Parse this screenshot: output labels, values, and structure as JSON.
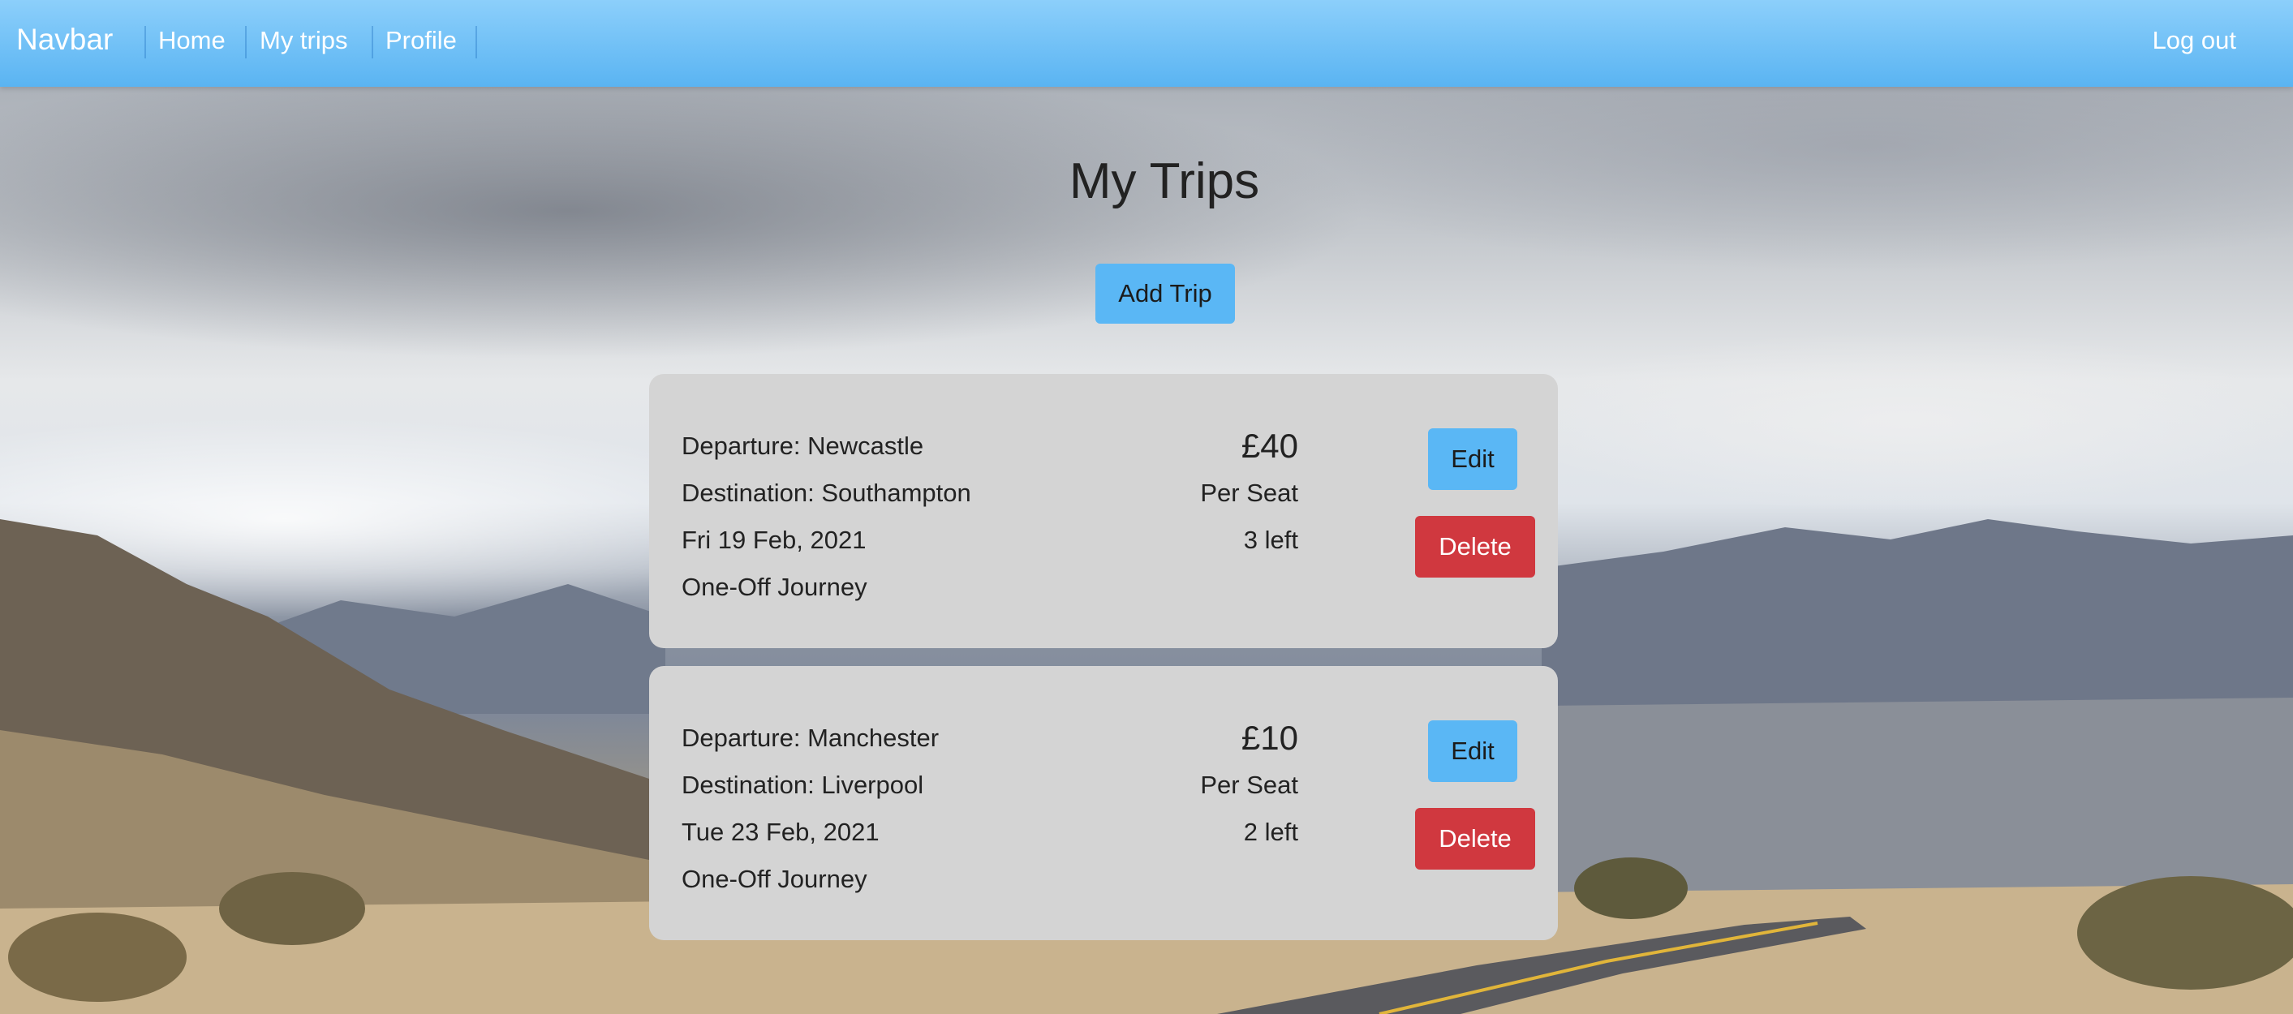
{
  "navbar": {
    "brand": "Navbar",
    "links": [
      "Home",
      "My trips",
      "Profile"
    ],
    "logout": "Log out"
  },
  "page": {
    "title": "My Trips",
    "add_button": "Add Trip"
  },
  "trips": [
    {
      "departure": "Departure: Newcastle",
      "destination": "Destination: Southampton",
      "date": "Fri 19 Feb, 2021",
      "journey_type": "One-Off Journey",
      "price": "£40",
      "per_seat": "Per Seat",
      "seats_left": "3 left",
      "edit_label": "Edit",
      "delete_label": "Delete"
    },
    {
      "departure": "Departure: Manchester",
      "destination": "Destination: Liverpool",
      "date": "Tue 23 Feb, 2021",
      "journey_type": "One-Off Journey",
      "price": "£10",
      "per_seat": "Per Seat",
      "seats_left": "2 left",
      "edit_label": "Edit",
      "delete_label": "Delete"
    }
  ],
  "colors": {
    "navbar": "#5ab4f2",
    "primary_button": "#5ab7f5",
    "danger_button": "#d0383f",
    "card": "#d4d4d4"
  }
}
